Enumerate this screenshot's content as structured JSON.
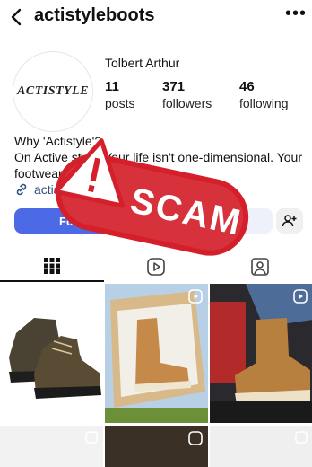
{
  "header": {
    "handle": "actistyleboots"
  },
  "profile": {
    "logo_text": "ACTISTYLE",
    "name": "Tolbert Arthur",
    "stats": [
      {
        "value": "11",
        "label": "posts"
      },
      {
        "value": "371",
        "label": "followers"
      },
      {
        "value": "46",
        "label": "following"
      }
    ],
    "bio_lines": [
      "Why 'Actistyle'?",
      "On Active style, Your life isn't one-dimensional. Your",
      "footwear shouldn't be either."
    ],
    "link_text": "actis"
  },
  "actions": {
    "follow_label": "Follow"
  },
  "overlay": {
    "stamp_text": "SCAM"
  },
  "colors": {
    "follow": "#4d6ae6",
    "stamp": "#d4202a",
    "link": "#30507f"
  },
  "icons": [
    "back-arrow-icon",
    "more-options-icon",
    "link-icon",
    "add-user-icon",
    "grid-icon",
    "reels-icon",
    "tagged-icon",
    "reel-indicator-icon",
    "warning-icon"
  ]
}
